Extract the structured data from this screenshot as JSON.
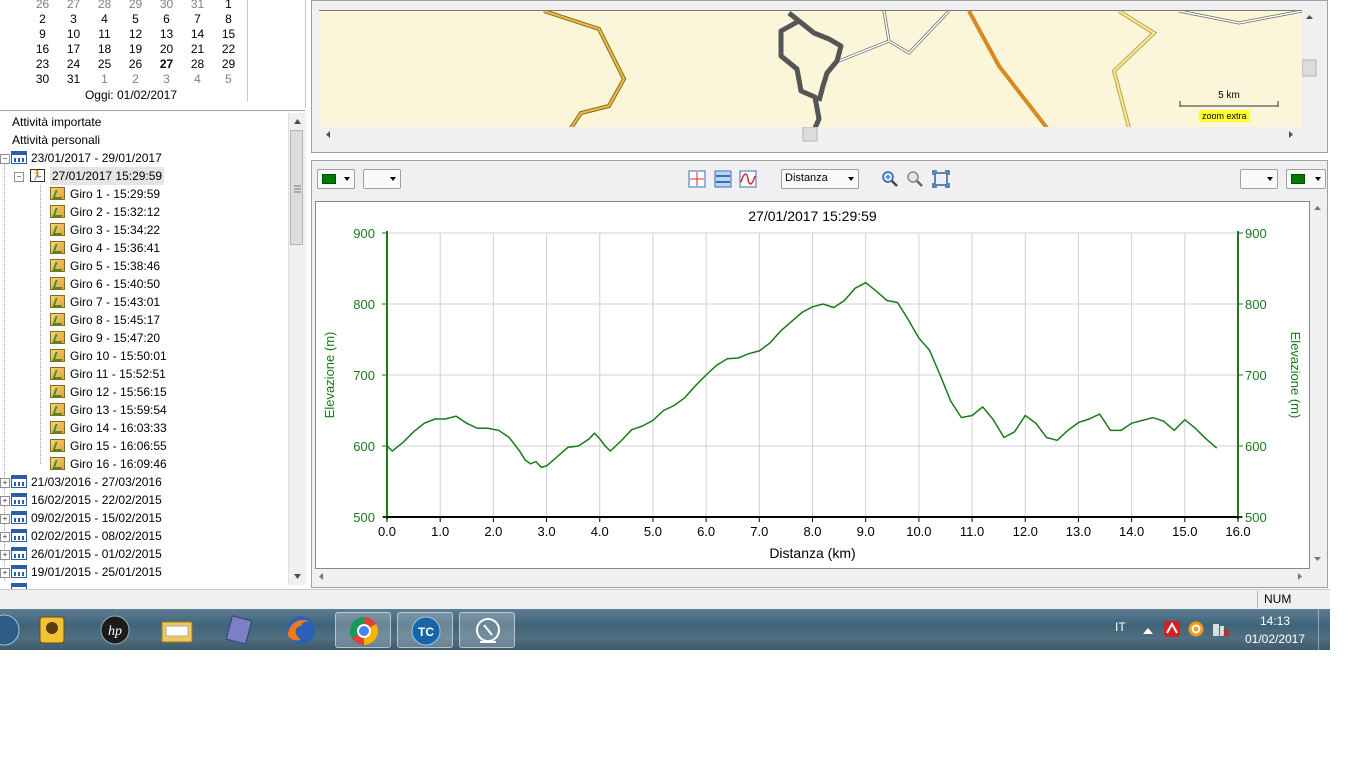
{
  "calendar": {
    "rows": [
      [
        "26",
        "27",
        "28",
        "29",
        "30",
        "31",
        "1"
      ],
      [
        "2",
        "3",
        "4",
        "5",
        "6",
        "7",
        "8"
      ],
      [
        "9",
        "10",
        "11",
        "12",
        "13",
        "14",
        "15"
      ],
      [
        "16",
        "17",
        "18",
        "19",
        "20",
        "21",
        "22"
      ],
      [
        "23",
        "24",
        "25",
        "26",
        "27",
        "28",
        "29"
      ],
      [
        "30",
        "31",
        "1",
        "2",
        "3",
        "4",
        "5"
      ]
    ],
    "today_label": "Oggi: 01/02/2017"
  },
  "tree": {
    "root_items": [
      "Attività importate",
      "Attività personali"
    ],
    "week_open": "23/01/2017 - 29/01/2017",
    "activity": "27/01/2017 15:29:59",
    "laps": [
      "Giro 1 - 15:29:59",
      "Giro 2 - 15:32:12",
      "Giro 3 - 15:34:22",
      "Giro 4 - 15:36:41",
      "Giro 5 - 15:38:46",
      "Giro 6 - 15:40:50",
      "Giro 7 - 15:43:01",
      "Giro 8 - 15:45:17",
      "Giro 9 - 15:47:20",
      "Giro 10 - 15:50:01",
      "Giro 11 - 15:52:51",
      "Giro 12 - 15:56:15",
      "Giro 13 - 15:59:54",
      "Giro 14 - 16:03:33",
      "Giro 15 - 16:06:55",
      "Giro 16 - 16:09:46"
    ],
    "weeks": [
      "21/03/2016 - 27/03/2016",
      "16/02/2015 - 22/02/2015",
      "09/02/2015 - 15/02/2015",
      "02/02/2015 - 08/02/2015",
      "26/01/2015 - 01/02/2015",
      "19/01/2015 - 25/01/2015"
    ]
  },
  "map": {
    "scale_label": "5 km",
    "zoom_label": "zoom extra"
  },
  "toolbar": {
    "x_axis_select": "Distanza"
  },
  "status": {
    "num": "NUM"
  },
  "tray": {
    "lang": "IT",
    "time": "14:13",
    "date": "01/02/2017"
  },
  "colors": {
    "series": "#1a7a1a",
    "axis": "#1a7a1a",
    "grid": "#d0d0d0"
  },
  "chart_data": {
    "type": "line",
    "title": "27/01/2017 15:29:59",
    "xlabel": "Distanza (km)",
    "ylabel": "Elevazione (m)",
    "ylabel_right": "Elevazione (m)",
    "xlim": [
      0,
      16
    ],
    "ylim": [
      500,
      900
    ],
    "x_ticks": [
      "0.0",
      "1.0",
      "2.0",
      "3.0",
      "4.0",
      "5.0",
      "6.0",
      "7.0",
      "8.0",
      "9.0",
      "10.0",
      "11.0",
      "12.0",
      "13.0",
      "14.0",
      "15.0",
      "16.0"
    ],
    "y_ticks": [
      "500",
      "600",
      "700",
      "800",
      "900"
    ],
    "grid": true,
    "series": [
      {
        "x": [
          0.0,
          0.1,
          0.3,
          0.5,
          0.7,
          0.9,
          1.1,
          1.3,
          1.5,
          1.7,
          1.9,
          2.1,
          2.3,
          2.5,
          2.6,
          2.7,
          2.8,
          2.9,
          3.0,
          3.2,
          3.4,
          3.6,
          3.8,
          3.9,
          4.0,
          4.1,
          4.2,
          4.4,
          4.6,
          4.8,
          5.0,
          5.2,
          5.4,
          5.6,
          5.8,
          6.0,
          6.2,
          6.4,
          6.6,
          6.8,
          7.0,
          7.2,
          7.4,
          7.6,
          7.8,
          8.0,
          8.2,
          8.4,
          8.6,
          8.8,
          9.0,
          9.2,
          9.4,
          9.6,
          9.8,
          10.0,
          10.2,
          10.4,
          10.6,
          10.8,
          11.0,
          11.2,
          11.4,
          11.6,
          11.8,
          12.0,
          12.2,
          12.4,
          12.6,
          12.8,
          13.0,
          13.2,
          13.4,
          13.6,
          13.8,
          14.0,
          14.2,
          14.4,
          14.6,
          14.8,
          15.0,
          15.2,
          15.4,
          15.6
        ],
        "y": [
          600,
          593,
          605,
          620,
          632,
          638,
          638,
          642,
          632,
          625,
          625,
          622,
          612,
          592,
          580,
          575,
          578,
          570,
          572,
          585,
          598,
          600,
          610,
          618,
          610,
          600,
          593,
          607,
          623,
          628,
          636,
          650,
          657,
          668,
          685,
          700,
          714,
          723,
          724,
          730,
          734,
          745,
          762,
          775,
          788,
          796,
          800,
          795,
          805,
          822,
          830,
          818,
          805,
          802,
          778,
          752,
          735,
          700,
          663,
          640,
          643,
          655,
          637,
          612,
          620,
          643,
          632,
          612,
          608,
          622,
          633,
          638,
          645,
          622,
          622,
          632,
          636,
          640,
          635,
          622,
          637,
          625,
          610,
          597
        ]
      }
    ]
  }
}
